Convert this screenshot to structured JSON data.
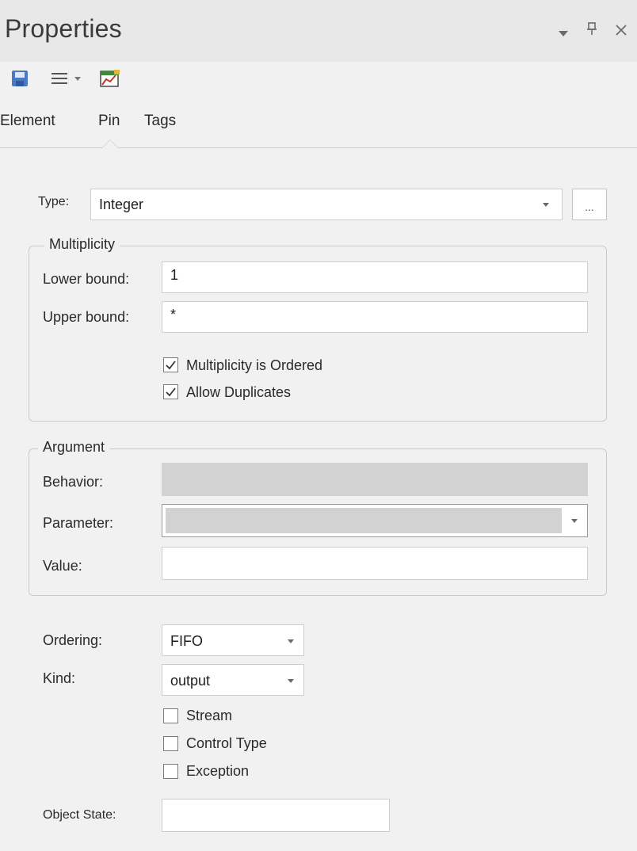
{
  "window": {
    "title": "Properties",
    "buttons": {
      "menu_icon": "dropdown-arrow-icon",
      "pin_icon": "pin-icon",
      "close_icon": "close-icon"
    }
  },
  "toolbar": {
    "items": [
      {
        "icon": "save-icon"
      },
      {
        "icon": "hamburger-menu-icon"
      },
      {
        "icon": "chart-image-icon"
      }
    ]
  },
  "tabs": [
    {
      "label": "Element",
      "active": false
    },
    {
      "label": "Pin",
      "active": true
    },
    {
      "label": "Tags",
      "active": false
    }
  ],
  "type_field": {
    "label": "Type:",
    "value": "Integer",
    "browse_label": "..."
  },
  "multiplicity": {
    "title": "Multiplicity",
    "lower_label": "Lower bound:",
    "lower_value": "1",
    "upper_label": "Upper bound:",
    "upper_value": "*",
    "ordered_label": "Multiplicity is Ordered",
    "ordered_checked": true,
    "duplicates_label": "Allow Duplicates",
    "duplicates_checked": true
  },
  "argument": {
    "title": "Argument",
    "behavior_label": "Behavior:",
    "behavior_value": "",
    "parameter_label": "Parameter:",
    "parameter_value": "",
    "value_label": "Value:",
    "value_value": ""
  },
  "ordering": {
    "label": "Ordering:",
    "value": "FIFO"
  },
  "kind": {
    "label": "Kind:",
    "value": "output"
  },
  "flags": {
    "stream_label": "Stream",
    "stream_checked": false,
    "control_type_label": "Control Type",
    "control_type_checked": false,
    "exception_label": "Exception",
    "exception_checked": false
  },
  "object_state": {
    "label": "Object State:",
    "value": ""
  },
  "colors": {
    "panel_bg": "#f1f1f1",
    "titlebar_bg": "#e8e8e8",
    "disabled_field": "#d2d2d2"
  }
}
